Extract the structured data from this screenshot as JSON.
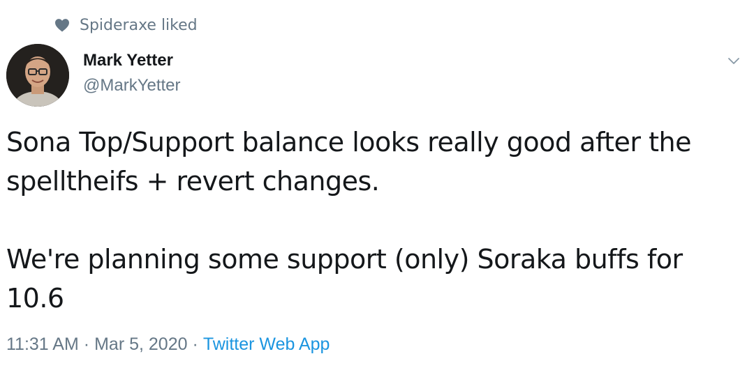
{
  "social_context": {
    "icon": "heart-icon",
    "text": "Spideraxe liked"
  },
  "author": {
    "name": "Mark Yetter",
    "handle": "@MarkYetter"
  },
  "menu": {
    "icon": "chevron-down-icon"
  },
  "tweet": {
    "paragraphs": [
      "Sona Top/Support balance looks really good after the spelltheifs + revert changes.",
      "We're planning some support (only) Soraka buffs for 10.6"
    ]
  },
  "meta": {
    "time": "11:31 AM",
    "separator_1": "·",
    "date": "Mar 5, 2020",
    "separator_2": "·",
    "source": "Twitter Web App"
  },
  "colors": {
    "text": "#14171a",
    "secondary": "#657786",
    "link": "#1b95e0"
  }
}
